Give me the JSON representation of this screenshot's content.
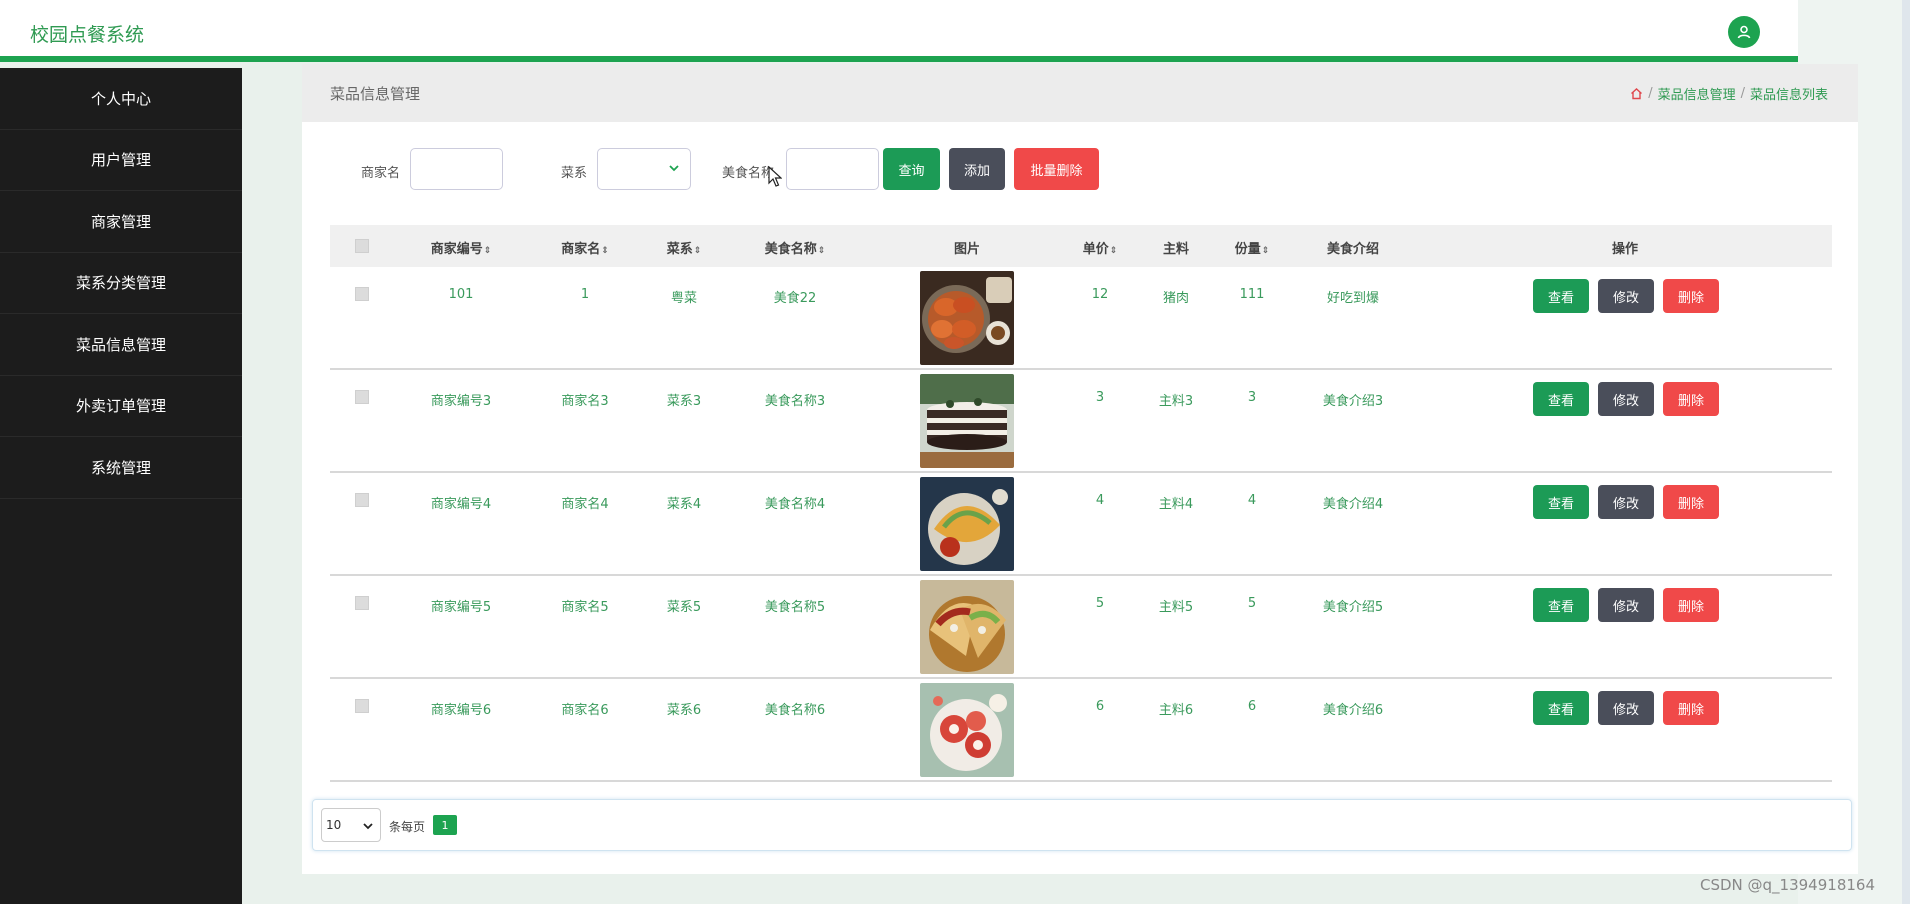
{
  "app": {
    "title": "校园点餐系统"
  },
  "sidebar": {
    "items": [
      {
        "label": "个人中心"
      },
      {
        "label": "用户管理"
      },
      {
        "label": "商家管理"
      },
      {
        "label": "菜系分类管理"
      },
      {
        "label": "菜品信息管理"
      },
      {
        "label": "外卖订单管理"
      },
      {
        "label": "系统管理"
      }
    ]
  },
  "page": {
    "title": "菜品信息管理",
    "breadcrumb": [
      "菜品信息管理",
      "菜品信息列表"
    ]
  },
  "search": {
    "merchant_label": "商家名",
    "merchant_value": "",
    "cuisine_label": "菜系",
    "cuisine_value": "",
    "food_label": "美食名称",
    "food_value": "",
    "query_button": "查询",
    "add_button": "添加",
    "batch_delete_button": "批量删除"
  },
  "table": {
    "headers": {
      "merchant_no": "商家编号",
      "merchant_name": "商家名",
      "cuisine": "菜系",
      "food_name": "美食名称",
      "image": "图片",
      "price": "单价",
      "main_ingredient": "主料",
      "portion": "份量",
      "intro": "美食介绍",
      "actions": "操作"
    },
    "rows": [
      {
        "merchant_no": "101",
        "merchant_name": "1",
        "cuisine": "粤菜",
        "food_name": "美食22",
        "image": "crab-dish",
        "price": "12",
        "main_ingredient": "猪肉",
        "portion": "111",
        "intro": "好吃到爆"
      },
      {
        "merchant_no": "商家编号3",
        "merchant_name": "商家名3",
        "cuisine": "菜系3",
        "food_name": "美食名称3",
        "image": "layer-cake",
        "price": "3",
        "main_ingredient": "主料3",
        "portion": "3",
        "intro": "美食介绍3"
      },
      {
        "merchant_no": "商家编号4",
        "merchant_name": "商家名4",
        "cuisine": "菜系4",
        "food_name": "美食名称4",
        "image": "pancake-plate",
        "price": "4",
        "main_ingredient": "主料4",
        "portion": "4",
        "intro": "美食介绍4"
      },
      {
        "merchant_no": "商家编号5",
        "merchant_name": "商家名5",
        "cuisine": "菜系5",
        "food_name": "美食名称5",
        "image": "tacos",
        "price": "5",
        "main_ingredient": "主料5",
        "portion": "5",
        "intro": "美食介绍5"
      },
      {
        "merchant_no": "商家编号6",
        "merchant_name": "商家名6",
        "cuisine": "菜系6",
        "food_name": "美食名称6",
        "image": "red-dessert",
        "price": "6",
        "main_ingredient": "主料6",
        "portion": "6",
        "intro": "美食介绍6"
      }
    ],
    "actions": {
      "view": "查看",
      "edit": "修改",
      "delete": "删除"
    }
  },
  "pagination": {
    "page_size": "10",
    "per_page_label": "条每页",
    "current_page": "1"
  },
  "watermark": "CSDN @q_1394918164",
  "colors": {
    "brand": "#1da350",
    "sidebar": "#1c1c1c",
    "link": "#3a9a5c",
    "danger": "#f04949",
    "dark_button": "#4a4e5a"
  }
}
